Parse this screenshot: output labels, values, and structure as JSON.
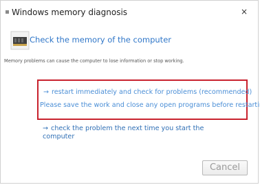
{
  "window": {
    "title": "Windows memory diagnosis",
    "close_glyph": "×"
  },
  "header": {
    "title": "Check the memory of the computer",
    "icon": "memory-chip-icon"
  },
  "warning": "Memory problems can cause the computer to lose information or stop working.",
  "options": {
    "restart_label": "restart immediately and check for problems (recommended)",
    "restart_desc": "Please save the work and close any open programs before restarting.",
    "next_time_label": "check the problem the next time you start the computer",
    "arrow_glyph": "→"
  },
  "footer": {
    "cancel_label": "Cancel"
  },
  "colors": {
    "link": "#2f76c8",
    "highlight_border": "#c8202c"
  }
}
